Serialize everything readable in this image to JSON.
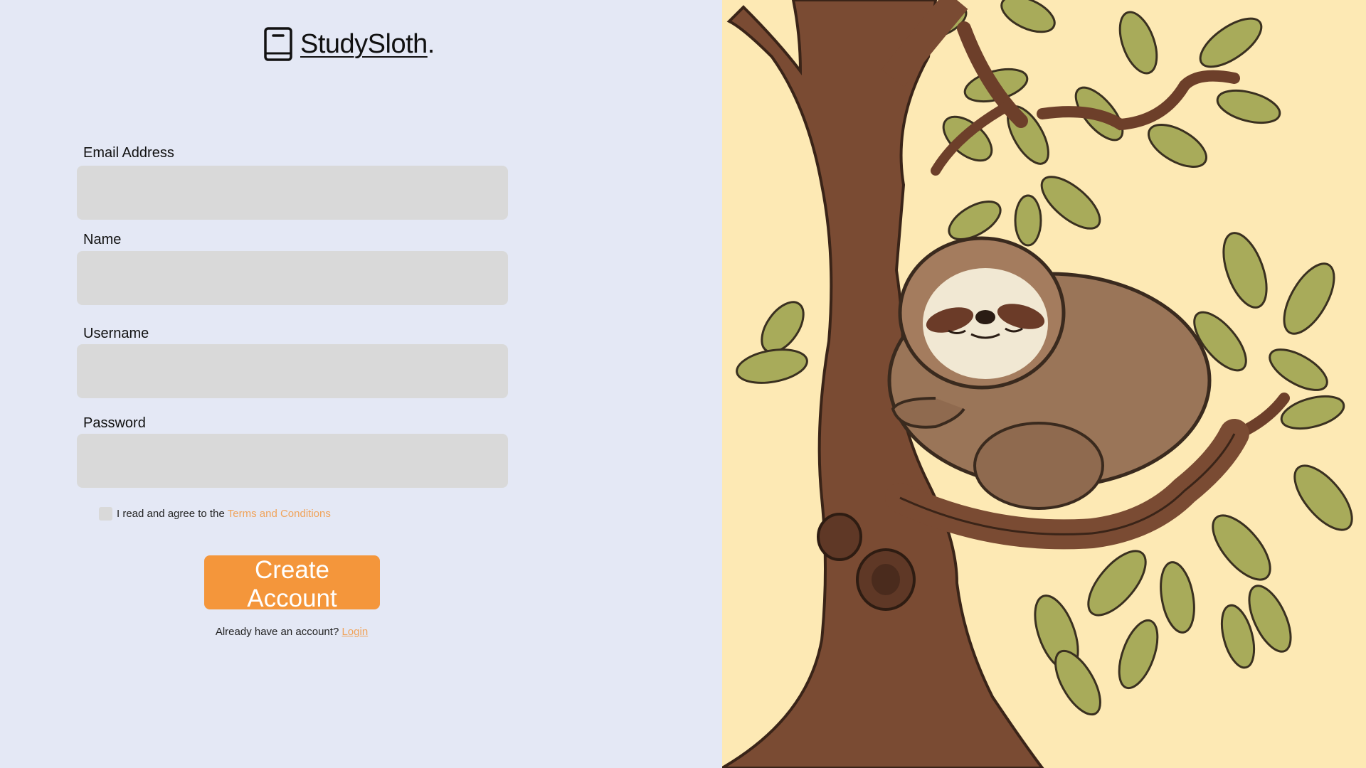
{
  "brand": {
    "name": "StudySloth",
    "dot": ".",
    "icon": "book-icon"
  },
  "form": {
    "email": {
      "label": "Email Address",
      "value": "",
      "placeholder": ""
    },
    "name": {
      "label": "Name",
      "value": "",
      "placeholder": ""
    },
    "username": {
      "label": "Username",
      "value": "",
      "placeholder": ""
    },
    "password": {
      "label": "Password",
      "value": "",
      "placeholder": ""
    },
    "terms": {
      "checked": false,
      "text": "I read and agree to the",
      "link_text": "Terms and Conditions"
    },
    "submit_label": "Create Account",
    "login_prompt": "Already have an account?",
    "login_link": "Login"
  },
  "illustration": {
    "icon": "sloth-on-tree-illustration"
  },
  "colors": {
    "left_background": "#e4e8f5",
    "right_background": "#fde9b4",
    "input_background": "#d9d9d9",
    "accent": "#f4963b",
    "link": "#f0a35a",
    "trunk": "#7a4b33",
    "sloth_fur": "#9a7558",
    "leaf": "#a8ab5a"
  }
}
